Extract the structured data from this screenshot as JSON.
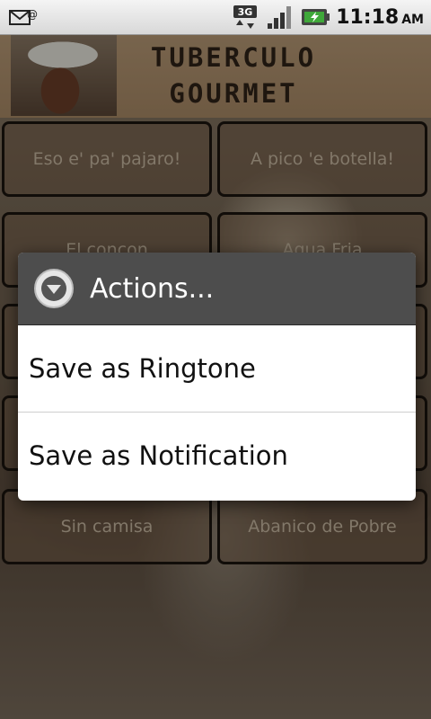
{
  "status_bar": {
    "time": "11:18",
    "ampm": "AM",
    "network_label": "3G",
    "icons": [
      "email-notification-icon",
      "3g-data-icon",
      "signal-strength-icon",
      "battery-charging-icon"
    ]
  },
  "header": {
    "title_line1": "TUBERCULO",
    "title_line2": "GOURMET"
  },
  "sounds": [
    {
      "label": "Eso e' pa' pajaro!"
    },
    {
      "label": "A pico 'e botella!"
    },
    {
      "label": "El concon"
    },
    {
      "label": "Agua Fria"
    },
    {
      "label": "Sin camisa"
    },
    {
      "label": "Abanico de Pobre"
    }
  ],
  "dialog": {
    "title": "Actions...",
    "items": [
      {
        "label": "Save as Ringtone"
      },
      {
        "label": "Save as Notification"
      }
    ]
  },
  "colors": {
    "dialog_header_bg": "#4d4d4d",
    "battery_accent": "#3fa83a"
  }
}
